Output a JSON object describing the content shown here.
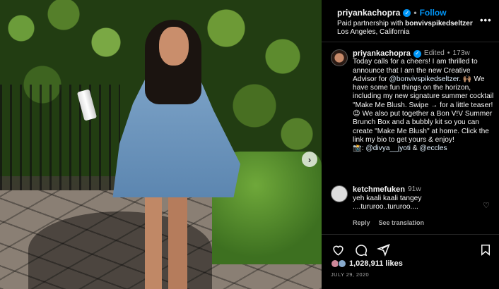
{
  "post": {
    "username": "priyankachopra",
    "follow_label": "Follow",
    "partnership_prefix": "Paid partnership with",
    "partner": "bonvivspikedseltzer",
    "location": "Los Angeles, California",
    "more_icon": "more-horizontal-icon",
    "next_icon": "chevron-right-icon",
    "verified_icon": "verified-badge-icon"
  },
  "caption": {
    "username": "priyankachopra",
    "edited": "Edited",
    "dot": "•",
    "age": "173w",
    "line_1": "Today calls for a cheers! I am thrilled to announce that I am the new Creative Advisor for",
    "mention_partner": "@bonvivspikedseltzer.",
    "emoji_1": "🙌🏽",
    "line_2": "We have some fun things on the horizon, including my new signature summer cocktail \"Make Me Blush. Swipe → for a little teaser!",
    "emoji_2": "😉",
    "line_3": "We also put together a Bon V!V Summer Brunch Box and a bubbly kit so you can create \"Make Me Blush\" at home. Click the link my bio to get yours & enjoy!",
    "camera_emoji": "📸",
    "credit_sep": ":",
    "credit_1": "@divya__jyoti",
    "credit_and": "&",
    "credit_2": "@eccles"
  },
  "comment": {
    "username": "ketchmefuken",
    "age": "91w",
    "line_1": "yeh kaali kaali tangey",
    "line_2": "....tururoo..tururoo....",
    "reply_label": "Reply",
    "translation_label": "See translation",
    "like_icon": "heart-outline-icon"
  },
  "actions": {
    "icons": [
      "heart-icon",
      "comment-icon",
      "share-icon",
      "bookmark-icon"
    ],
    "likes": "1,028,911 likes",
    "date": "JULY 29, 2020"
  }
}
